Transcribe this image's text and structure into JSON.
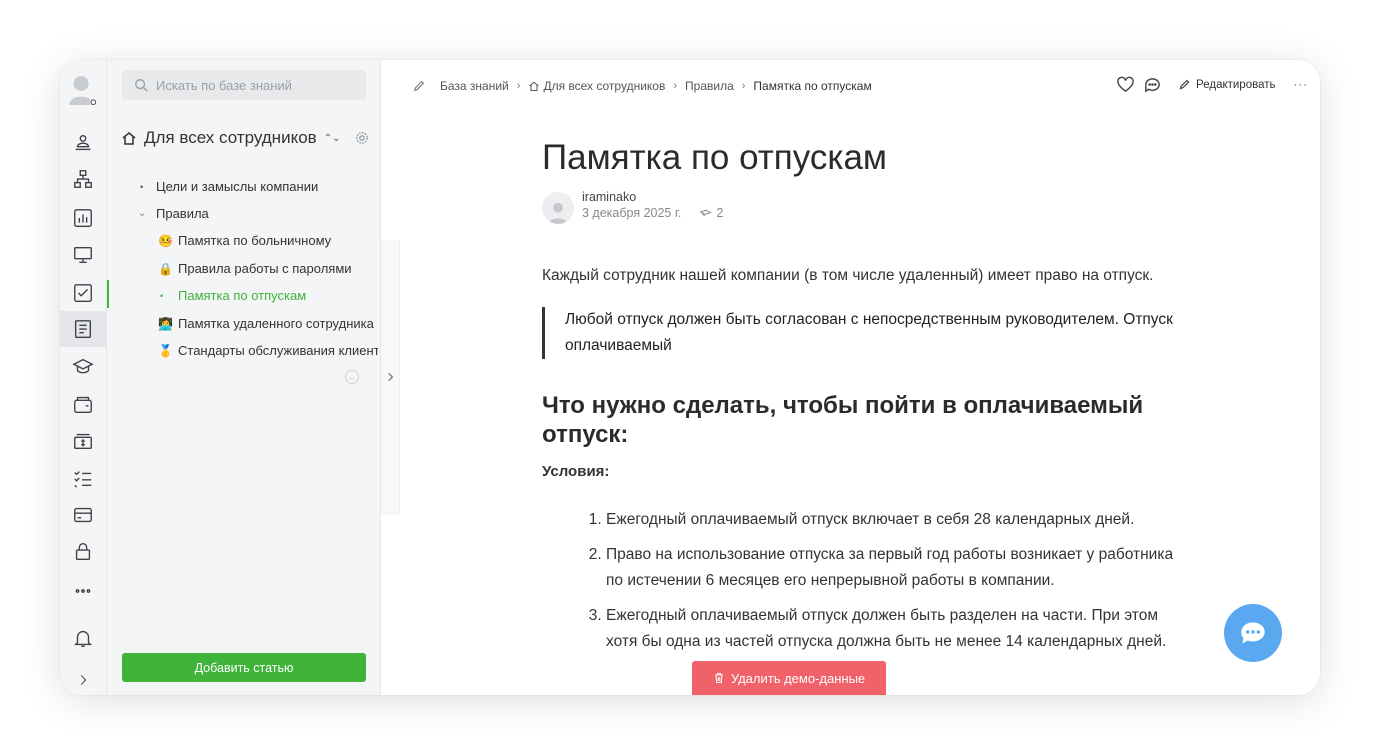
{
  "sidebar": {
    "search_placeholder": "Искать по базе знаний",
    "space_title": "Для всех сотрудников",
    "tree": [
      {
        "label": "Цели и замыслы компании"
      },
      {
        "label": "Правила"
      },
      {
        "label": "Памятка по больничному",
        "emoji": "🤒"
      },
      {
        "label": "Правила работы с паролями",
        "emoji": "🔒"
      },
      {
        "label": "Памятка по отпускам"
      },
      {
        "label": "Памятка удаленного сотрудника",
        "emoji": "👩‍💻"
      },
      {
        "label": "Стандарты обслуживания клиент",
        "emoji": "🥇"
      }
    ],
    "add_button": "Добавить статью"
  },
  "breadcrumb": {
    "items": [
      "База знаний",
      "Для всех сотрудников",
      "Правила"
    ],
    "current": "Памятка по отпускам"
  },
  "toolbar": {
    "edit_label": "Редактировать"
  },
  "article": {
    "title": "Памятка по отпускам",
    "author": "iraminako",
    "date": "3 декабря 2025 г.",
    "views": "2",
    "intro": "Каждый сотрудник нашей компании (в том числе удаленный) имеет право на отпуск.",
    "quote": "Любой отпуск должен быть согласован с непосредственным руководителем. Отпуск оплачиваемый",
    "heading": "Что нужно сделать, чтобы пойти в оплачиваемый отпуск:",
    "conditions_label": "Условия:",
    "list": [
      "Ежегодный оплачиваемый отпуск включает в себя 28 календарных дней.",
      "Право на использование отпуска за первый год работы возникает у работника по истечении 6 месяцев его непрерывной работы в компании.",
      "Ежегодный оплачиваемый отпуск должен быть разделен на части. При этом хотя бы одна из частей отпуска должна быть не менее 14 календарных дней."
    ]
  },
  "demo_button": "Удалить демо-данные",
  "colors": {
    "accent": "#3fb33a",
    "danger": "#f0616a",
    "chat": "#5aa8f0"
  }
}
